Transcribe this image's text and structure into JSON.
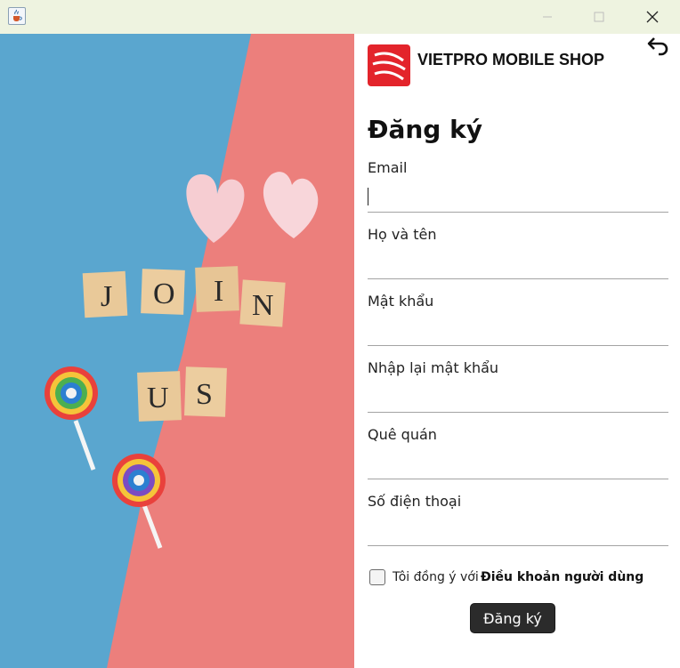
{
  "window": {
    "icon": "java-cup-icon",
    "controls": [
      "minimize-icon",
      "maximize-icon",
      "close-icon"
    ]
  },
  "banner": {
    "tiles_row1": [
      "J",
      "O",
      "I",
      "N"
    ],
    "tiles_row2": [
      "U",
      "S"
    ],
    "colors": {
      "blue": "#5aa6cf",
      "coral": "#ec7f7c",
      "heart": "#f6cdd2",
      "tile": "#e9c999"
    }
  },
  "header": {
    "logo": "vietpro-logo-icon",
    "shop_name": "VIETPRO MOBILE SHOP",
    "back_icon": "undo-arrow-icon"
  },
  "form": {
    "title": "Đăng ký",
    "fields": [
      {
        "label": "Email",
        "value": ""
      },
      {
        "label": "Họ và tên",
        "value": ""
      },
      {
        "label": "Mật khẩu",
        "value": ""
      },
      {
        "label": "Nhập lại mật khẩu",
        "value": ""
      },
      {
        "label": "Quê quán",
        "value": ""
      },
      {
        "label": "Số điện thoại",
        "value": ""
      }
    ],
    "agree_text": "Tôi đồng ý với",
    "agree_checked": false,
    "terms_link": "Điều khoản người dùng",
    "submit_label": "Đăng ký"
  },
  "colors": {
    "accent_red": "#e3242b",
    "button_dark": "#2b2b2b",
    "titlebar": "#eef3e0"
  }
}
